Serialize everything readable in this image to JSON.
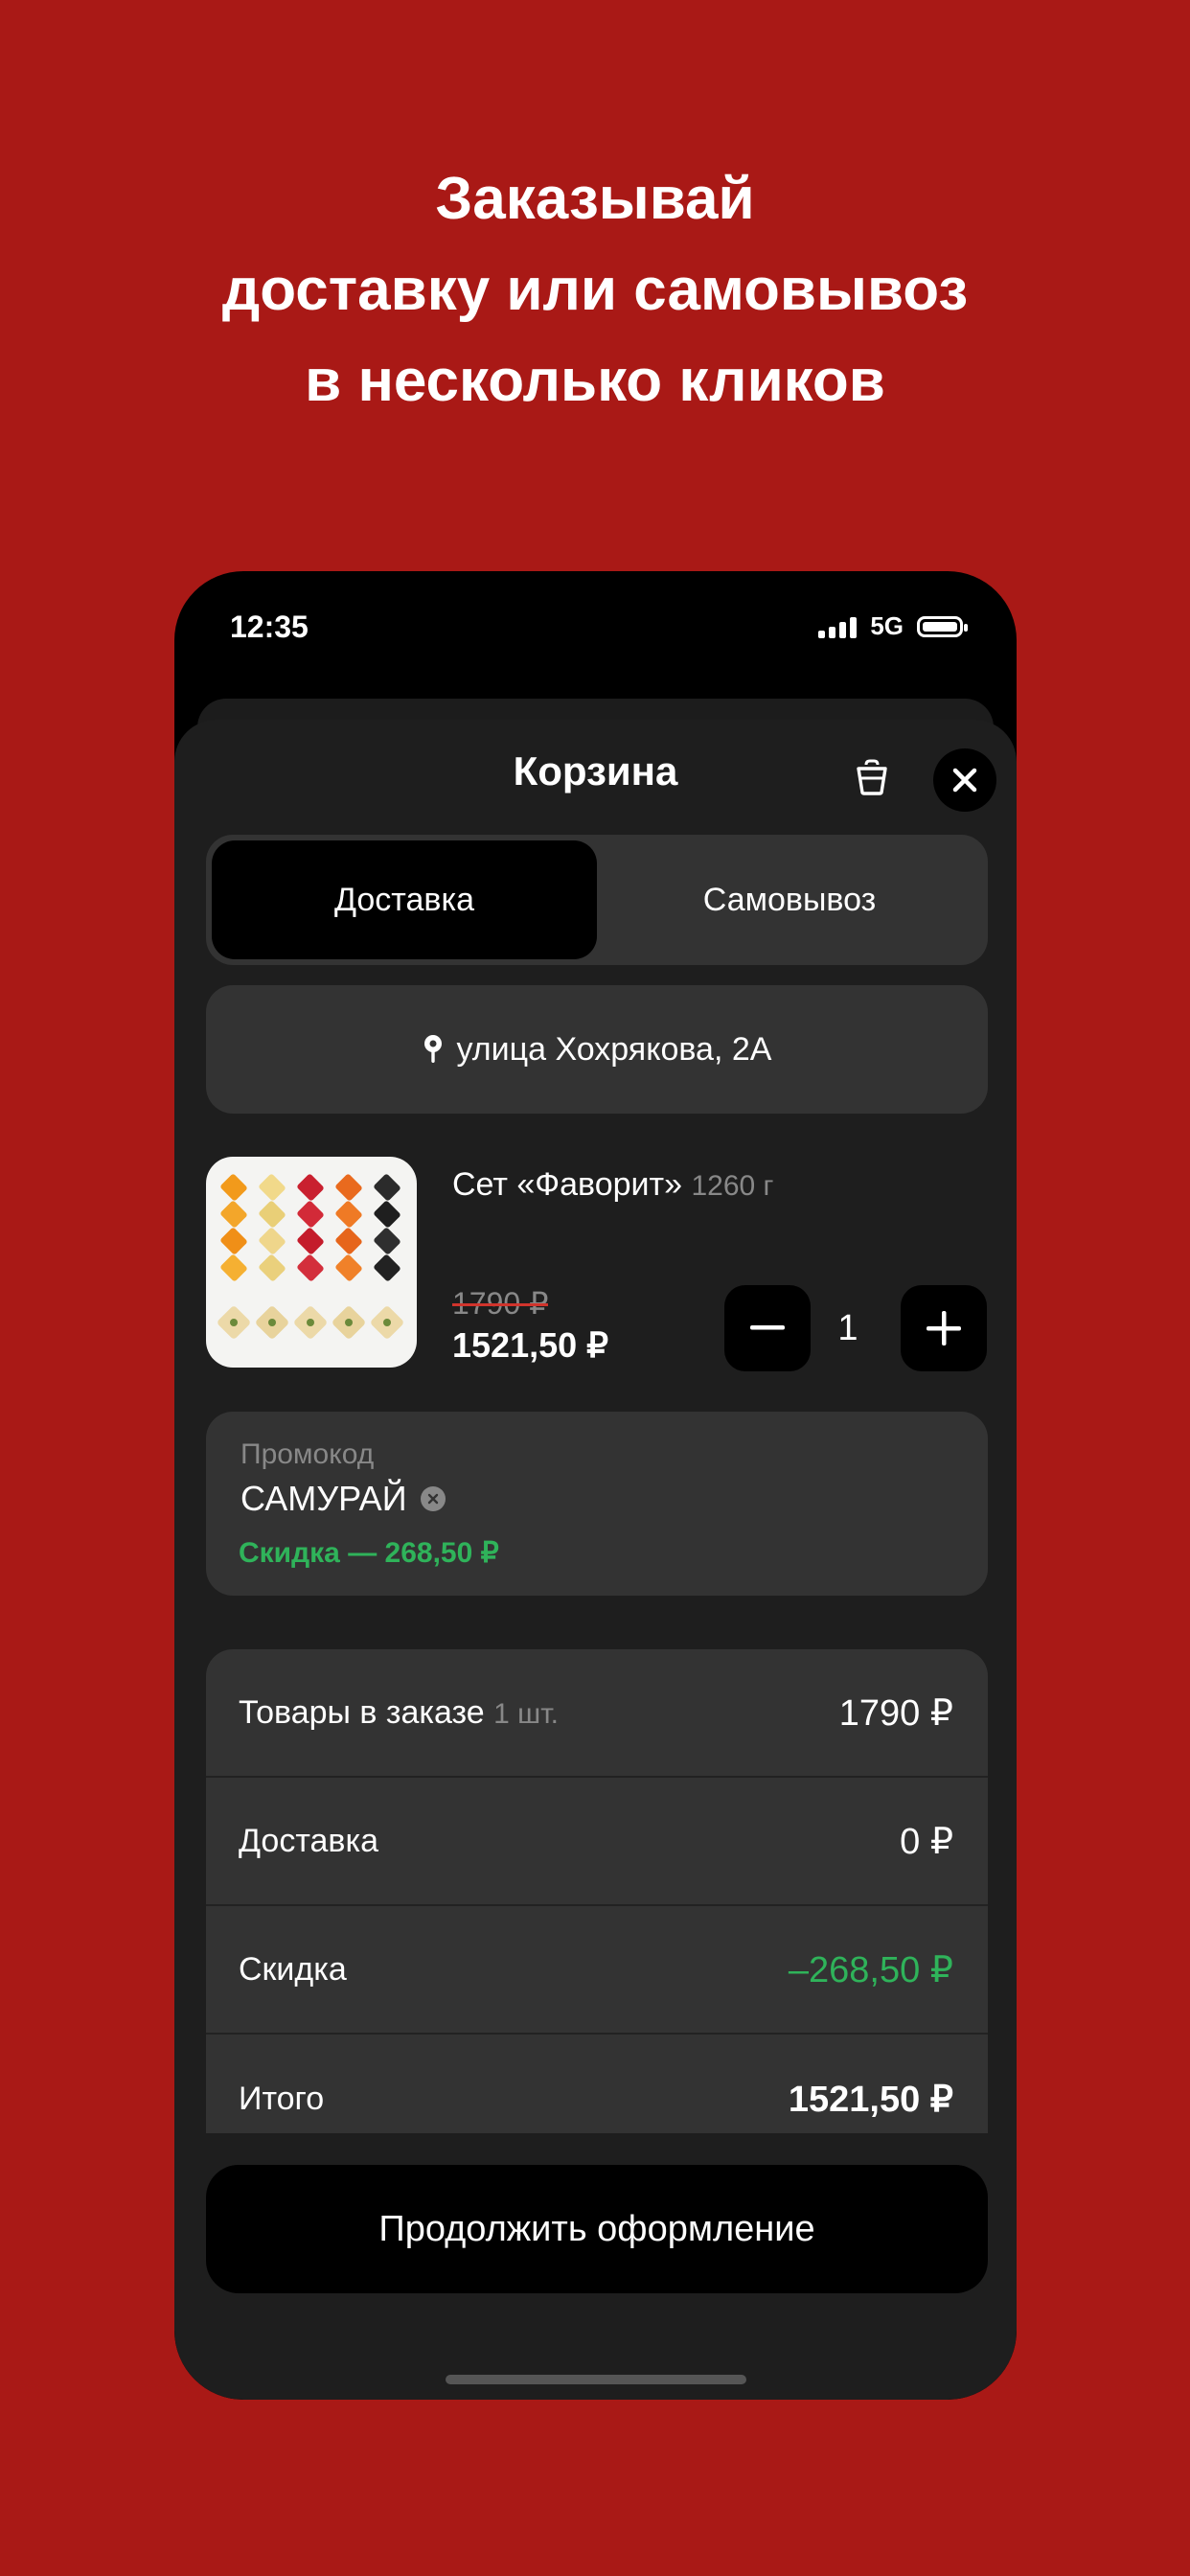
{
  "headline": {
    "line1": "Заказывай",
    "line2": "доставку или самовывоз",
    "line3": "в несколько кликов"
  },
  "status_bar": {
    "time": "12:35",
    "network": "5G"
  },
  "cart": {
    "title": "Корзина",
    "tabs": [
      {
        "label": "Доставка",
        "active": true
      },
      {
        "label": "Самовывоз",
        "active": false
      }
    ],
    "address": "улица Хохрякова, 2А",
    "item": {
      "name": "Сет «Фаворит»",
      "weight": "1260 г",
      "old_price": "1790 ₽",
      "new_price": "1521,50 ₽",
      "quantity": "1"
    },
    "promo": {
      "label": "Промокод",
      "code": "САМУРАЙ",
      "discount": "Скидка — 268,50 ₽"
    },
    "summary": [
      {
        "label": "Товары в заказе",
        "note": "1 шт.",
        "value": "1790 ₽"
      },
      {
        "label": "Доставка",
        "note": "",
        "value": "0 ₽"
      },
      {
        "label": "Скидка",
        "note": "",
        "value": "–268,50 ₽"
      },
      {
        "label": "Итого",
        "note": "",
        "value": "1521,50 ₽"
      }
    ],
    "checkout_label": "Продолжить оформление"
  },
  "colors": {
    "background": "#a91916",
    "discount_green": "#2fb35a",
    "surface": "#333333"
  }
}
